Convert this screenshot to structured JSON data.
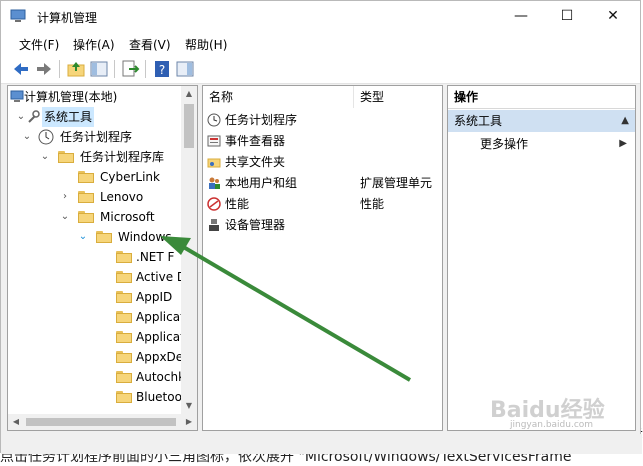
{
  "background_text": {
    "left_fragment": "在",
    "right_fragment": "示",
    "caption": "点击任务计划程序前面的小三角图标，依次展开 \"Microsoft/Windows/TextServicesFrame"
  },
  "window": {
    "title": "计算机管理",
    "controls": {
      "minimize": "—",
      "maximize": "☐",
      "close": "✕"
    }
  },
  "menu": [
    "文件(F)",
    "操作(A)",
    "查看(V)",
    "帮助(H)"
  ],
  "tree": {
    "root": "计算机管理(本地)",
    "system_tools": "系统工具",
    "task_scheduler": "任务计划程序",
    "task_library": "任务计划程序库",
    "cyberlink": "CyberLink",
    "lenovo": "Lenovo",
    "microsoft": "Microsoft",
    "windows": "Windows",
    "windows_children": [
      ".NET F",
      "Active D",
      "AppID",
      "Applicat",
      "Applicat",
      "AppxDe",
      "Autochk",
      "Bluetoo"
    ]
  },
  "list": {
    "columns": {
      "name": "名称",
      "type": "类型"
    },
    "rows": [
      {
        "name": "任务计划程序",
        "type": "",
        "icon": "task-scheduler-icon"
      },
      {
        "name": "事件查看器",
        "type": "",
        "icon": "event-viewer-icon"
      },
      {
        "name": "共享文件夹",
        "type": "",
        "icon": "shared-folder-icon"
      },
      {
        "name": "本地用户和组",
        "type": "扩展管理单元",
        "icon": "users-icon"
      },
      {
        "name": "性能",
        "type": "性能",
        "icon": "performance-icon"
      },
      {
        "name": "设备管理器",
        "type": "",
        "icon": "device-manager-icon"
      }
    ]
  },
  "actions": {
    "header": "操作",
    "section": "系统工具",
    "more": "更多操作"
  },
  "watermark": "Baidu经验",
  "watermark_sub": "jingyan.baidu.com",
  "colors": {
    "selection": "#cce8ff",
    "action_section": "#cfe0f2",
    "arrow": "#3a8a3a"
  }
}
